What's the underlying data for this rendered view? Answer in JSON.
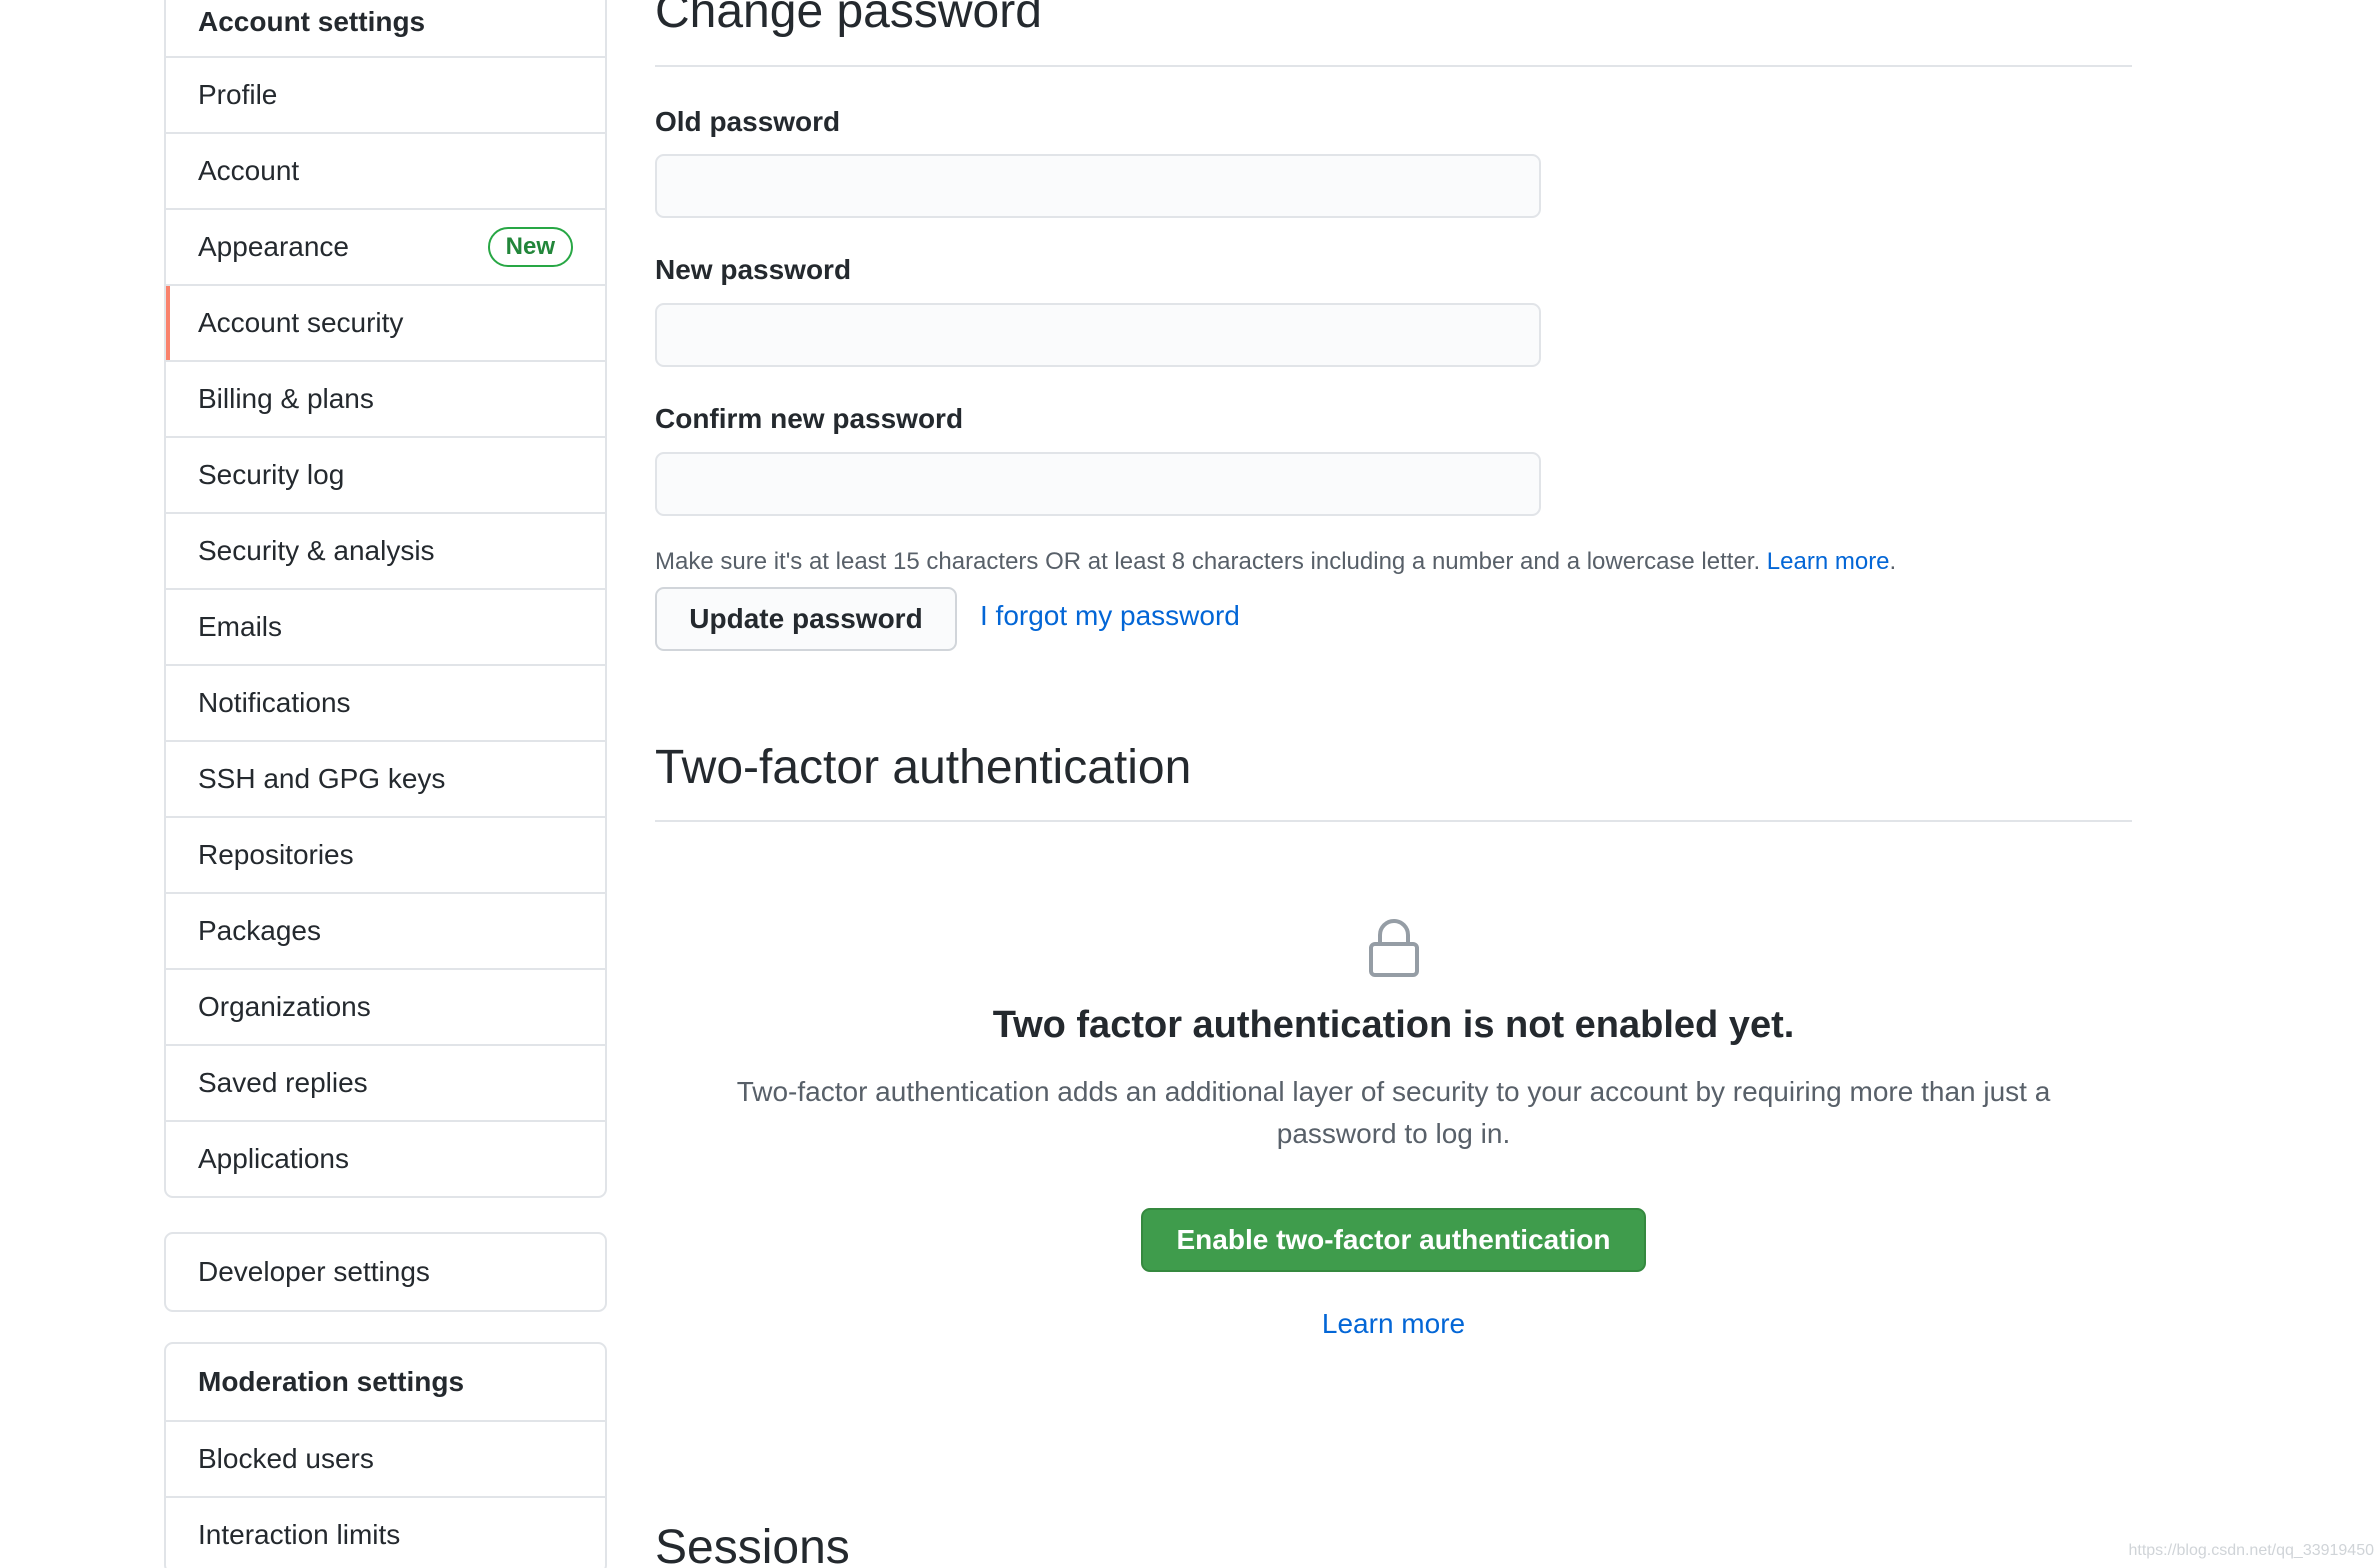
{
  "sidebar": {
    "account_heading": "Account settings",
    "items": [
      {
        "label": "Profile"
      },
      {
        "label": "Account"
      },
      {
        "label": "Appearance",
        "badge": "New"
      },
      {
        "label": "Account security",
        "selected": true
      },
      {
        "label": "Billing & plans"
      },
      {
        "label": "Security log"
      },
      {
        "label": "Security & analysis"
      },
      {
        "label": "Emails"
      },
      {
        "label": "Notifications"
      },
      {
        "label": "SSH and GPG keys"
      },
      {
        "label": "Repositories"
      },
      {
        "label": "Packages"
      },
      {
        "label": "Organizations"
      },
      {
        "label": "Saved replies"
      },
      {
        "label": "Applications"
      }
    ],
    "developer_settings": "Developer settings",
    "moderation_heading": "Moderation settings",
    "moderation_items": [
      {
        "label": "Blocked users"
      },
      {
        "label": "Interaction limits"
      }
    ]
  },
  "change_password": {
    "title": "Change password",
    "old_label": "Old password",
    "old_value": "",
    "new_label": "New password",
    "new_value": "",
    "confirm_label": "Confirm new password",
    "confirm_value": "",
    "note": "Make sure it's at least 15 characters OR at least 8 characters including a number and a lowercase letter.",
    "note_link": "Learn more",
    "note_suffix": ".",
    "update_button": "Update password",
    "forgot_link": "I forgot my password"
  },
  "two_factor": {
    "title": "Two-factor authentication",
    "icon": "lock-icon",
    "status_title": "Two factor authentication is not enabled yet.",
    "description": "Two-factor authentication adds an additional layer of security to your account by requiring more than just a password to log in.",
    "enable_button": "Enable two-factor authentication",
    "learn_more": "Learn more"
  },
  "sessions": {
    "title": "Sessions"
  },
  "watermark": "https://blog.csdn.net/qq_33919450",
  "colors": {
    "link": "#0366d6",
    "selected_bar": "#f9826c",
    "primary_button": "#3f9c4c",
    "badge": "#28a745"
  }
}
